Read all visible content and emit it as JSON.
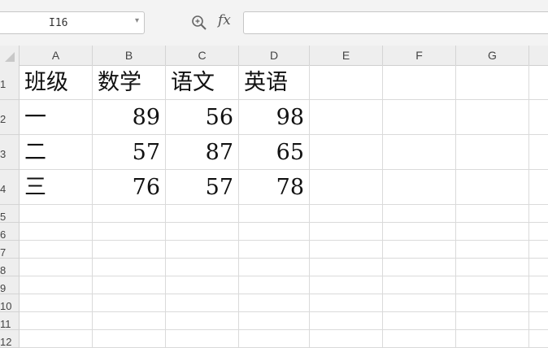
{
  "formula_bar": {
    "name_box": "I16",
    "fx_label": "fx",
    "formula": ""
  },
  "columns": [
    "A",
    "B",
    "C",
    "D",
    "E",
    "F",
    "G"
  ],
  "rows": [
    "1",
    "2",
    "3",
    "4",
    "5",
    "6",
    "7",
    "8",
    "9",
    "10",
    "11",
    "12"
  ],
  "cells": {
    "A1": "班级",
    "B1": "数学",
    "C1": "语文",
    "D1": "英语",
    "A2": "一",
    "B2": "89",
    "C2": "56",
    "D2": "98",
    "A3": "二",
    "B3": "57",
    "C3": "87",
    "D3": "65",
    "A4": "三",
    "B4": "76",
    "C4": "57",
    "D4": "78"
  },
  "icons": {
    "zoom": "magnifier-icon",
    "namebox_dropdown": "chevron-down-icon"
  }
}
